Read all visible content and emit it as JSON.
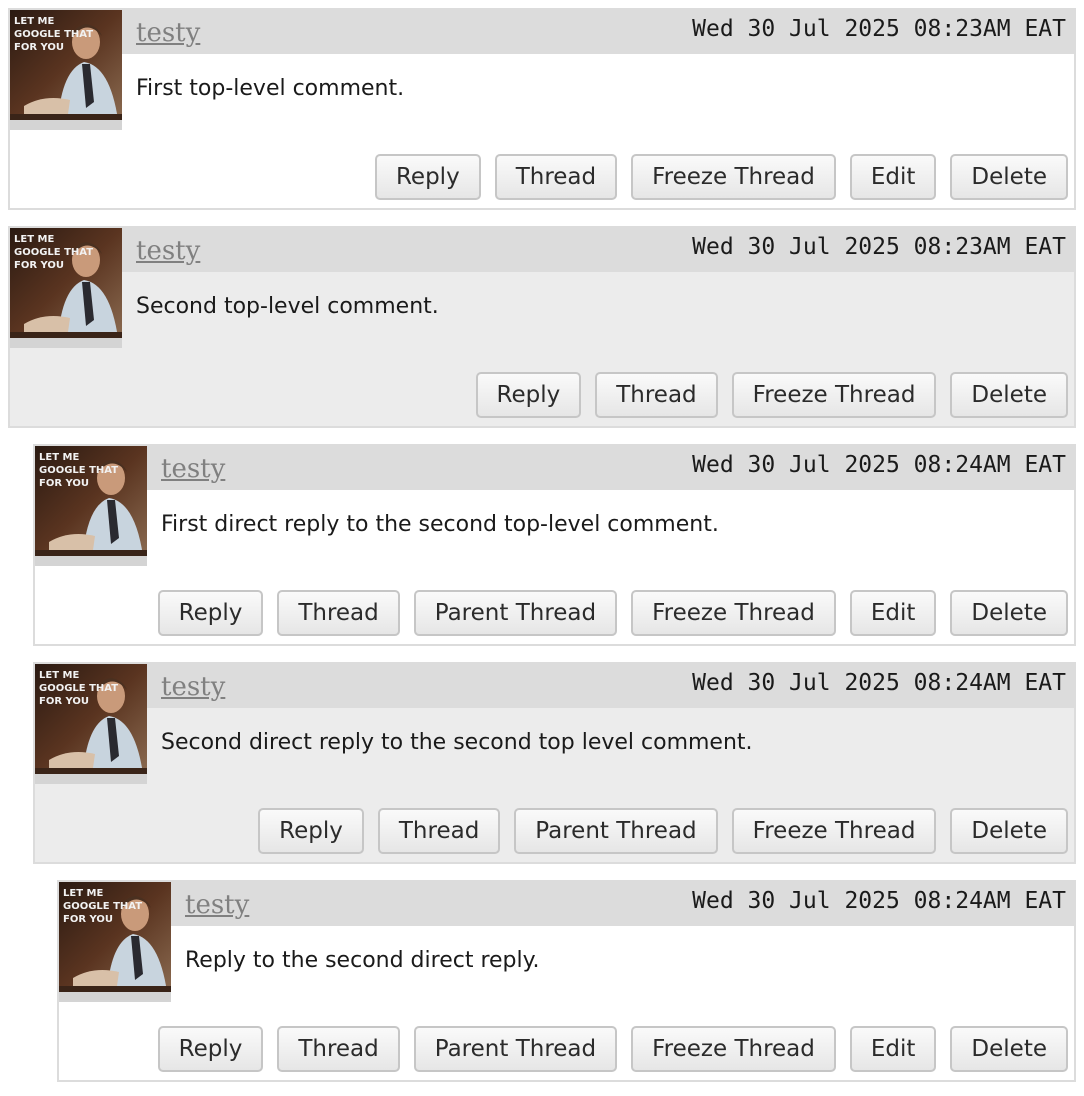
{
  "avatar_logo_text": "LET ME GOOGLE THAT FOR YOU",
  "comments": [
    {
      "username": "testy",
      "timestamp": "Wed 30 Jul 2025 08:23AM EAT",
      "text": "First top-level comment.",
      "buttons": [
        "Reply",
        "Thread",
        "Freeze Thread",
        "Edit",
        "Delete"
      ]
    },
    {
      "username": "testy",
      "timestamp": "Wed 30 Jul 2025 08:23AM EAT",
      "text": "Second top-level comment.",
      "buttons": [
        "Reply",
        "Thread",
        "Freeze Thread",
        "Delete"
      ]
    },
    {
      "username": "testy",
      "timestamp": "Wed 30 Jul 2025 08:24AM EAT",
      "text": "First direct reply to the second top-level comment.",
      "buttons": [
        "Reply",
        "Thread",
        "Parent Thread",
        "Freeze Thread",
        "Edit",
        "Delete"
      ]
    },
    {
      "username": "testy",
      "timestamp": "Wed 30 Jul 2025 08:24AM EAT",
      "text": "Second direct reply to the second top level comment.",
      "buttons": [
        "Reply",
        "Thread",
        "Parent Thread",
        "Freeze Thread",
        "Delete"
      ]
    },
    {
      "username": "testy",
      "timestamp": "Wed 30 Jul 2025 08:24AM EAT",
      "text": "Reply to the second direct reply.",
      "buttons": [
        "Reply",
        "Thread",
        "Parent Thread",
        "Freeze Thread",
        "Edit",
        "Delete"
      ]
    }
  ]
}
